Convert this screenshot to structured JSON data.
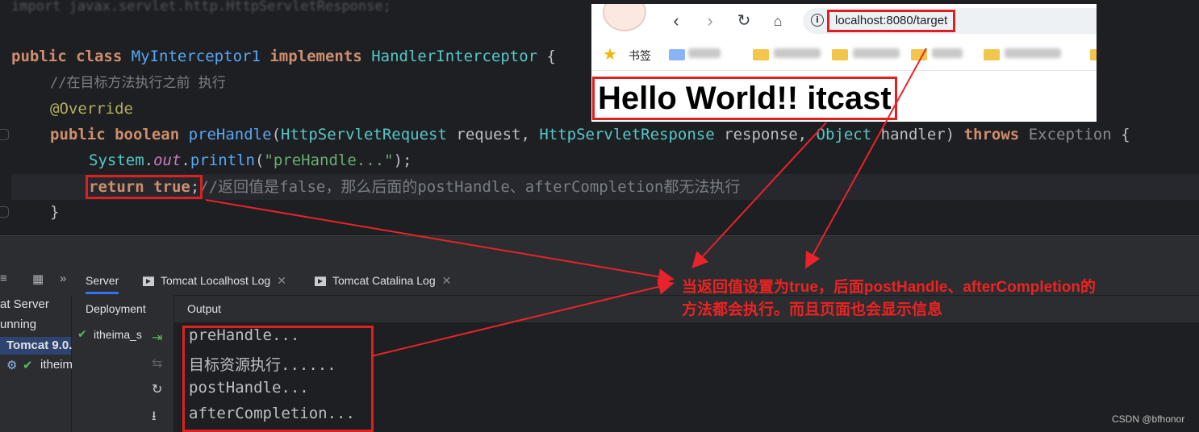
{
  "editor": {
    "import_line": "import javax.servlet.http.HttpServletResponse;",
    "class_line": {
      "kw1": "public class",
      "name": "MyInterceptor1",
      "kw2": "implements",
      "iface": "HandlerInterceptor",
      "brace": "{"
    },
    "comment_line": "//在目标方法执行之前 执行",
    "annotation": "@Override",
    "method_line": {
      "kw": "public boolean",
      "name": "preHandle",
      "p1_type": "HttpServletRequest",
      "p1_name": "request",
      "p2_type": "HttpServletResponse",
      "p2_name": "response",
      "p3_type": "Object",
      "p3_name": "handler",
      "throws": "throws",
      "exc": "Exception",
      "brace": "{"
    },
    "println_line": {
      "cls": "System",
      "field": "out",
      "method": "println",
      "arg": "\"preHandle...\""
    },
    "return_line": {
      "code": "return true",
      "semi": ";",
      "comment": "//返回值是false，那么后面的postHandle、afterCompletion都无法执行"
    },
    "close_brace": "}"
  },
  "browser": {
    "back_icon": "back-arrow-icon",
    "forward_icon": "forward-arrow-icon",
    "reload_icon": "reload-icon",
    "home_icon": "home-icon",
    "url": "localhost:8080/target",
    "bookmarks_label": "书签",
    "page_heading": "Hello World!! itcast"
  },
  "tool_window": {
    "tabs": [
      {
        "label": "Server"
      },
      {
        "label": "Tomcat Localhost Log"
      },
      {
        "label": "Tomcat Catalina Log"
      }
    ],
    "left_panel": {
      "row1": "at Server",
      "row2": "unning",
      "row3": "Tomcat 9.0.",
      "row4": "itheim"
    },
    "deployment_header": "Deployment",
    "output_header": "Output",
    "deployment_item": "itheima_s",
    "output_lines": [
      "preHandle...",
      "目标资源执行......",
      "postHandle...",
      "afterCompletion..."
    ]
  },
  "annotation": {
    "line1": "当返回值设置为true，后面postHandle、afterCompletion的",
    "line2": "方法都会执行。而且页面也会显示信息"
  },
  "watermark": "CSDN @bfhonor",
  "colors": {
    "highlight_red": "#e02020",
    "annotation_red": "#ee2222",
    "editor_bg": "#1e1f22",
    "panel_bg": "#2b2d30"
  }
}
